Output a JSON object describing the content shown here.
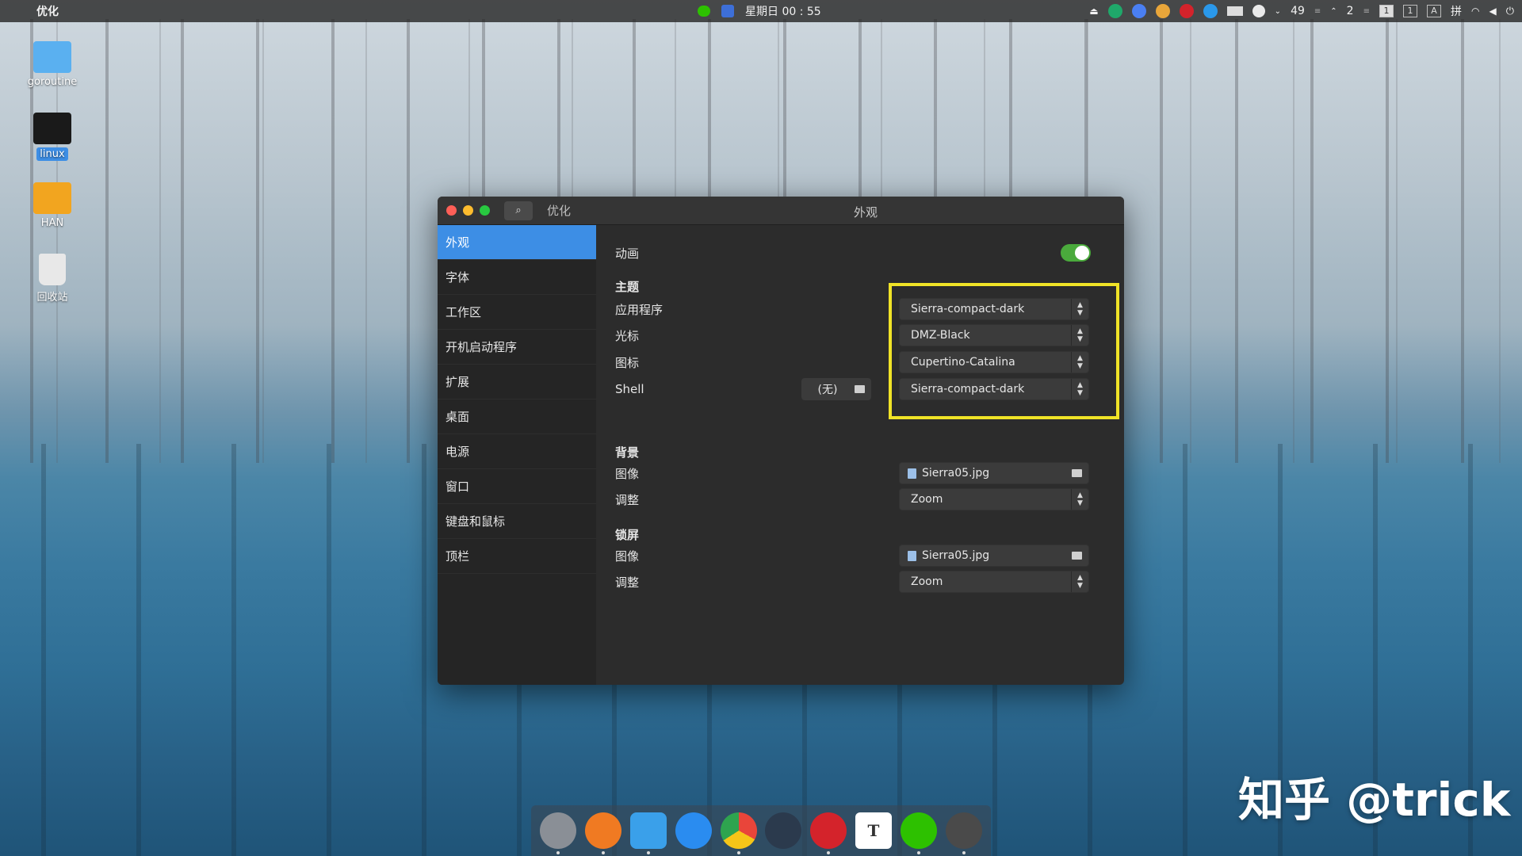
{
  "topbar": {
    "app_name": "优化",
    "clock": "星期日 00 : 55",
    "tray_number_1": "49",
    "tray_number_2": "2",
    "workspace_1": "1",
    "workspace_2": "1",
    "workspace_3": "A",
    "input_method": "拼"
  },
  "desktop": {
    "icons": [
      {
        "label": "goroutine",
        "color": "#5ab0f0"
      },
      {
        "label": "linux",
        "color": "#1a1a1a"
      },
      {
        "label": "HAN",
        "color": "#f2a51f"
      },
      {
        "label": "回收站",
        "color": "#e8e8e8"
      }
    ]
  },
  "window": {
    "app_title": "优化",
    "page_title": "外观",
    "sidebar": [
      {
        "label": "外观",
        "active": true
      },
      {
        "label": "字体"
      },
      {
        "label": "工作区"
      },
      {
        "label": "开机启动程序"
      },
      {
        "label": "扩展"
      },
      {
        "label": "桌面"
      },
      {
        "label": "电源"
      },
      {
        "label": "窗口"
      },
      {
        "label": "键盘和鼠标"
      },
      {
        "label": "顶栏"
      }
    ],
    "animation": {
      "label": "动画",
      "enabled": true
    },
    "themes": {
      "heading": "主题",
      "applications": {
        "label": "应用程序",
        "value": "Sierra-compact-dark"
      },
      "cursor": {
        "label": "光标",
        "value": "DMZ-Black"
      },
      "icons": {
        "label": "图标",
        "value": "Cupertino-Catalina"
      },
      "shell": {
        "label": "Shell",
        "none_label": "(无)",
        "value": "Sierra-compact-dark"
      }
    },
    "background": {
      "heading": "背景",
      "image": {
        "label": "图像",
        "value": "Sierra05.jpg"
      },
      "adjust": {
        "label": "调整",
        "value": "Zoom"
      }
    },
    "lockscreen": {
      "heading": "锁屏",
      "image": {
        "label": "图像",
        "value": "Sierra05.jpg"
      },
      "adjust": {
        "label": "调整",
        "value": "Zoom"
      }
    }
  },
  "dock": {
    "apps": [
      {
        "name": "launchpad-icon",
        "color": "#8a8f96"
      },
      {
        "name": "firefox-icon",
        "color": "#f07a22"
      },
      {
        "name": "finder-icon",
        "color": "#3aa0ea"
      },
      {
        "name": "app-store-icon",
        "color": "#2a8cf0"
      },
      {
        "name": "chrome-icon",
        "color": "#e9453a"
      },
      {
        "name": "steam-icon",
        "color": "#2b3a4d"
      },
      {
        "name": "netease-music-icon",
        "color": "#d4232b"
      },
      {
        "name": "typora-icon",
        "color": "#ffffff"
      },
      {
        "name": "wechat-icon",
        "color": "#2dc100"
      },
      {
        "name": "settings-icon",
        "color": "#4a4a4a"
      }
    ],
    "typora_letter": "T"
  },
  "watermark": "知乎 @trick",
  "colors": {
    "accent": "#3d8ee5",
    "toggle_on": "#4aaa3c",
    "highlight": "#f0e327"
  }
}
